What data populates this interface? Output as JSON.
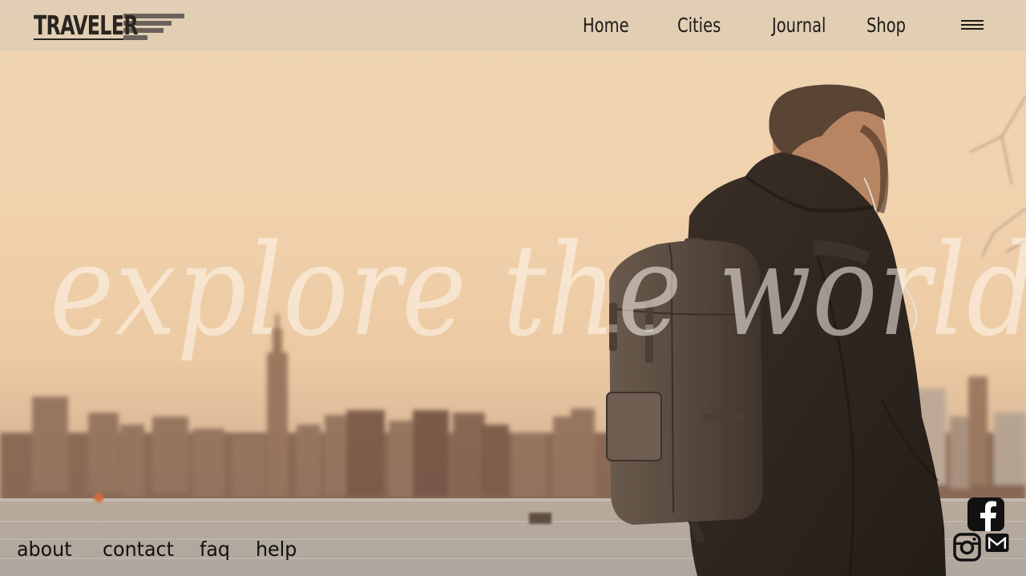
{
  "brand": {
    "name": "TRAVELER"
  },
  "nav": {
    "items": [
      {
        "label": "Home"
      },
      {
        "label": "Cities"
      },
      {
        "label": "Journal"
      },
      {
        "label": "Shop"
      }
    ],
    "menu_icon": "hamburger-menu-icon"
  },
  "hero": {
    "headline": "explore the world"
  },
  "footer": {
    "links": [
      {
        "label": "about"
      },
      {
        "label": "contact"
      },
      {
        "label": "faq"
      },
      {
        "label": "help"
      }
    ]
  },
  "social": {
    "icons": [
      "facebook-icon",
      "instagram-icon",
      "mail-icon"
    ]
  },
  "colors": {
    "text_dark": "#1d1a17",
    "header_bg": "#d6c8b4",
    "headline": "#fff8ee"
  }
}
